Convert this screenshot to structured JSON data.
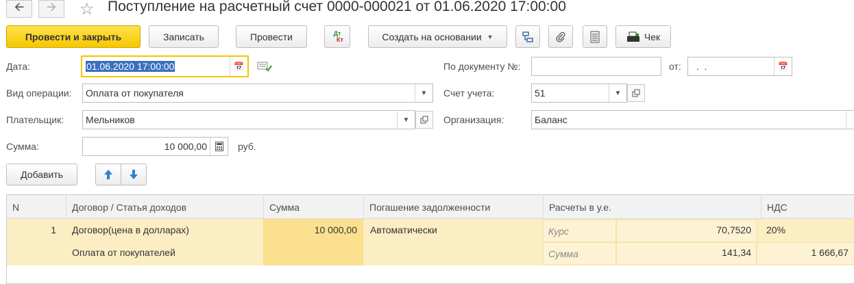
{
  "window": {
    "title": "Поступление на расчетный счет 0000-000021 от 01.06.2020 17:00:00"
  },
  "toolbar": {
    "post_and_close": "Провести и закрыть",
    "save": "Записать",
    "post": "Провести",
    "dt_kt_top": "Дт",
    "dt_kt_bottom": "Кт",
    "create_based_on": "Создать на основании",
    "check": "Чек"
  },
  "form": {
    "date_label": "Дата:",
    "date_value": "01.06.2020 17:00:00",
    "operation_label": "Вид операции:",
    "operation_value": "Оплата от покупателя",
    "payer_label": "Плательщик:",
    "payer_value": "Мельников",
    "amount_label": "Сумма:",
    "amount_value": "10 000,00",
    "currency": "руб.",
    "doc_number_label": "По документу №:",
    "doc_number_value": "",
    "from_label": "от:",
    "from_value": " .  .",
    "account_label": "Счет учета:",
    "account_value": "51",
    "organization_label": "Организация:",
    "organization_value": "Баланс"
  },
  "table_toolbar": {
    "add": "Добавить"
  },
  "table": {
    "columns": [
      "N",
      "Договор / Статья доходов",
      "Сумма",
      "Погашение задолженности",
      "Расчеты в у.е.",
      "НДС"
    ],
    "rows": [
      {
        "n": "1",
        "contract": "Договор(цена в долларах)",
        "income_item": "Оплата от покупателей",
        "sum": "10 000,00",
        "repayment": "Автоматически",
        "rate_label": "Курс",
        "rate_value": "70,7520",
        "ue_sum_label": "Сумма",
        "ue_sum_value": "141,34",
        "vat_rate": "20%",
        "vat_sum": "1 666,67"
      }
    ]
  },
  "colors": {
    "primary_button": "#f6c700",
    "row_highlight": "#fbeec3",
    "selected_text": "#3b6fbf"
  }
}
